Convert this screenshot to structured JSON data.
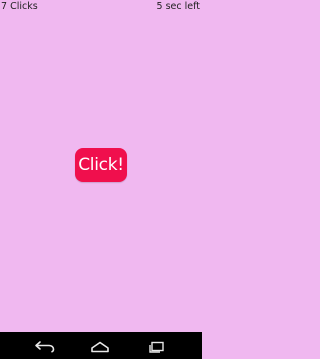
{
  "status": {
    "clicks_label": "7 Clicks",
    "time_label": "5 sec left"
  },
  "main": {
    "button_label": "Click!"
  },
  "colors": {
    "background": "#f0b8f0",
    "button": "#f00f4d",
    "button_text": "#ffffff",
    "nav_bar": "#000000"
  },
  "nav": {
    "icons": [
      "back-icon",
      "home-icon",
      "recent-apps-icon"
    ]
  }
}
